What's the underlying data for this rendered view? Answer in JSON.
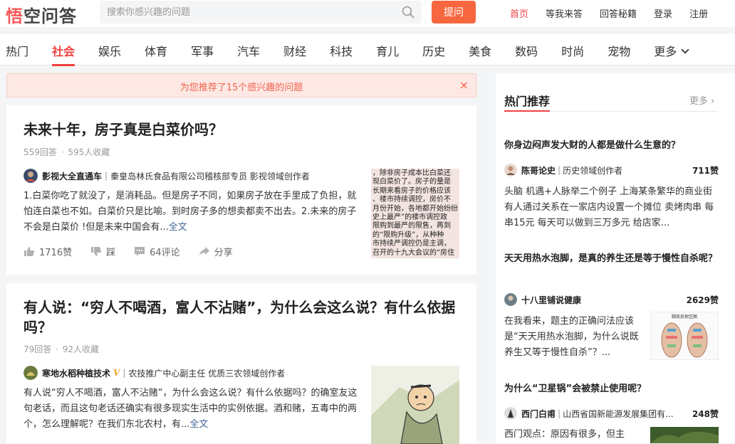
{
  "header": {
    "logo": {
      "part1": "悟",
      "part2": "空问答"
    },
    "search_placeholder": "搜索你感兴趣的问题",
    "ask_button": "提问",
    "nav": [
      {
        "label": "首页",
        "active": true
      },
      {
        "label": "等我来答",
        "active": false
      },
      {
        "label": "回答秘籍",
        "active": false
      },
      {
        "label": "登录",
        "active": false
      },
      {
        "label": "注册",
        "active": false
      }
    ]
  },
  "categories": [
    "热门",
    "社会",
    "娱乐",
    "体育",
    "军事",
    "汽车",
    "财经",
    "科技",
    "育儿",
    "历史",
    "美食",
    "数码",
    "时尚",
    "宠物",
    "更多"
  ],
  "active_category": "社会",
  "notice": {
    "text": "为您推荐了15个感兴趣的问题",
    "close": "×"
  },
  "questions": [
    {
      "title": "未来十年，房子真是白菜价吗？",
      "answers": "559回答",
      "collects": "595人收藏",
      "author_name": "影视大全直通车",
      "author_desc": "秦皇岛林氏食品有限公司稽核部专员 影视领域创作者",
      "excerpt": "1.白菜你吃了就没了，是消耗品。但是房子不同，如果房子放在手里成了负担，就怕连白菜也不如。白菜价只是比喻。到时房子多的想卖都卖不出去。2.未来的房子不会是白菜价 !但是未来中国会有...",
      "full_link": "全文",
      "likes": "1716赞",
      "dislike": "踩",
      "comments": "64评论",
      "share": "分享",
      "thumb_lines": [
        "，除非房子成本比白菜还",
        "现白菜价了。房子的量是",
        "长期来看房子的价格应该",
        "、楼市持续调控，房价不",
        "月份开始，各地都开始纷纷",
        "史上最严”的楼市调控政",
        "限购到最严的限售，再到",
        "的“限购升级”，从种种",
        "市持续严调控仍是主调，",
        "召开的十九大会议的“房住"
      ]
    },
    {
      "title": "有人说：“穷人不喝酒，富人不沾赌”，为什么会这么说？有什么依据吗？",
      "answers": "79回答",
      "collects": "92人收藏",
      "author_name": "寒地水稻种植技术",
      "author_badge": "V",
      "author_desc": "农技推广中心副主任 优质三农领域创作者",
      "excerpt": "有人说“穷人不喝酒，富人不沾赌”，为什么会这么说？有什么依据吗？的确室友这句老话，而且这句老话还确实有很多现实生活中的实例依据。酒和赌，五毒中的两个，怎么理解呢？在我们东北农村，有...",
      "full_link": "全文"
    }
  ],
  "hot": {
    "title": "热门推荐",
    "more": "更多",
    "items": [
      {
        "question": "你身边闷声发大财的人都是做什么生意的？",
        "author_name": "陈哥论史",
        "author_desc": "历史领域创作者",
        "likes": "711赞",
        "text": "头脑 机遇+人脉举二个例子 上海某条繁华的商业街 有人通过关系在一家店内设置一个摊位 卖烤肉串 每串15元 每天可以做到三万多元 给店家..."
      },
      {
        "question": "天天用热水泡脚，是真的养生还是等于慢性自杀呢？",
        "author_name": "十八里铺说健康",
        "likes": "2629赞",
        "text": "在我看来，题主的正确问法应该是“天天用热水泡脚，为什么说既养生又等于慢性自杀”？...",
        "thumb_caption": "脚底反射区图"
      },
      {
        "question": "为什么“卫星锅”会被禁止使用呢？",
        "author_name": "西门白甫",
        "author_desc": "山西省国新能源发展集团有...",
        "likes": "248赞",
        "text": "西门观点：原因有很多，但主"
      }
    ]
  },
  "colors": {
    "brand": "#f04142",
    "ask_button": "#f7673f",
    "link": "#406599",
    "notice_bg": "#fde8e4"
  }
}
